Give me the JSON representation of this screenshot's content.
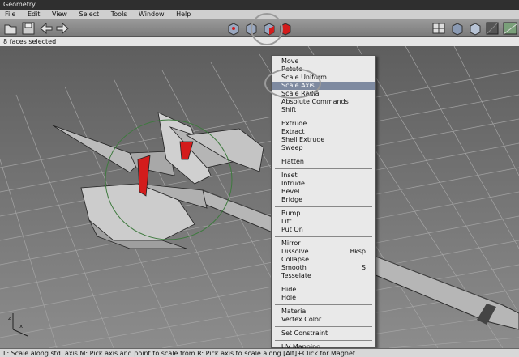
{
  "window": {
    "title": "Geometry"
  },
  "menubar": [
    "File",
    "Edit",
    "View",
    "Select",
    "Tools",
    "Window",
    "Help"
  ],
  "toolbar": {
    "left_icons": [
      "folder-icon",
      "save-icon",
      "undo-arrow-icon",
      "redo-arrow-icon"
    ],
    "center_icons": [
      "select-vertex-icon",
      "select-edge-icon",
      "select-face-icon",
      "select-body-icon"
    ],
    "right_icons": [
      "workmode-icon",
      "shaded-cube-icon",
      "wire-cube-icon",
      "smooth-shading-icon",
      "perspective-icon"
    ],
    "accent_red": "#d31c1c"
  },
  "status_top": "8 faces selected",
  "context_menu": {
    "items": [
      {
        "label": "Move",
        "shortcut": "",
        "selected": false,
        "sep_after": false
      },
      {
        "label": "Rotate",
        "shortcut": "",
        "selected": false,
        "sep_after": false
      },
      {
        "label": "Scale Uniform",
        "shortcut": "",
        "selected": false,
        "sep_after": false
      },
      {
        "label": "Scale Axis",
        "shortcut": "",
        "selected": true,
        "sep_after": false
      },
      {
        "label": "Scale Radial",
        "shortcut": "",
        "selected": false,
        "sep_after": false
      },
      {
        "label": "Absolute Commands",
        "shortcut": "",
        "selected": false,
        "sep_after": false
      },
      {
        "label": "Shift",
        "shortcut": "",
        "selected": false,
        "sep_after": true
      },
      {
        "label": "Extrude",
        "shortcut": "",
        "selected": false,
        "sep_after": false
      },
      {
        "label": "Extract",
        "shortcut": "",
        "selected": false,
        "sep_after": false
      },
      {
        "label": "Shell Extrude",
        "shortcut": "",
        "selected": false,
        "sep_after": false
      },
      {
        "label": "Sweep",
        "shortcut": "",
        "selected": false,
        "sep_after": true
      },
      {
        "label": "Flatten",
        "shortcut": "",
        "selected": false,
        "sep_after": true
      },
      {
        "label": "Inset",
        "shortcut": "",
        "selected": false,
        "sep_after": false
      },
      {
        "label": "Intrude",
        "shortcut": "",
        "selected": false,
        "sep_after": false
      },
      {
        "label": "Bevel",
        "shortcut": "",
        "selected": false,
        "sep_after": false
      },
      {
        "label": "Bridge",
        "shortcut": "",
        "selected": false,
        "sep_after": true
      },
      {
        "label": "Bump",
        "shortcut": "",
        "selected": false,
        "sep_after": false
      },
      {
        "label": "Lift",
        "shortcut": "",
        "selected": false,
        "sep_after": false
      },
      {
        "label": "Put On",
        "shortcut": "",
        "selected": false,
        "sep_after": true
      },
      {
        "label": "Mirror",
        "shortcut": "",
        "selected": false,
        "sep_after": false
      },
      {
        "label": "Dissolve",
        "shortcut": "Bksp",
        "selected": false,
        "sep_after": false
      },
      {
        "label": "Collapse",
        "shortcut": "",
        "selected": false,
        "sep_after": false
      },
      {
        "label": "Smooth",
        "shortcut": "S",
        "selected": false,
        "sep_after": false
      },
      {
        "label": "Tesselate",
        "shortcut": "",
        "selected": false,
        "sep_after": true
      },
      {
        "label": "Hide",
        "shortcut": "",
        "selected": false,
        "sep_after": false
      },
      {
        "label": "Hole",
        "shortcut": "",
        "selected": false,
        "sep_after": true
      },
      {
        "label": "Material",
        "shortcut": "",
        "selected": false,
        "sep_after": false
      },
      {
        "label": "Vertex Color",
        "shortcut": "",
        "selected": false,
        "sep_after": true
      },
      {
        "label": "Set Constraint",
        "shortcut": "",
        "selected": false,
        "sep_after": true
      },
      {
        "label": "UV Mapping",
        "shortcut": "",
        "selected": false,
        "sep_after": false
      }
    ]
  },
  "status_bottom": "L: Scale along std. axis   M: Pick axis and point to scale from   R: Pick axis to scale along   [Alt]+Click for Magnet",
  "viewport": {
    "axis_labels": [
      "z",
      "x"
    ]
  }
}
